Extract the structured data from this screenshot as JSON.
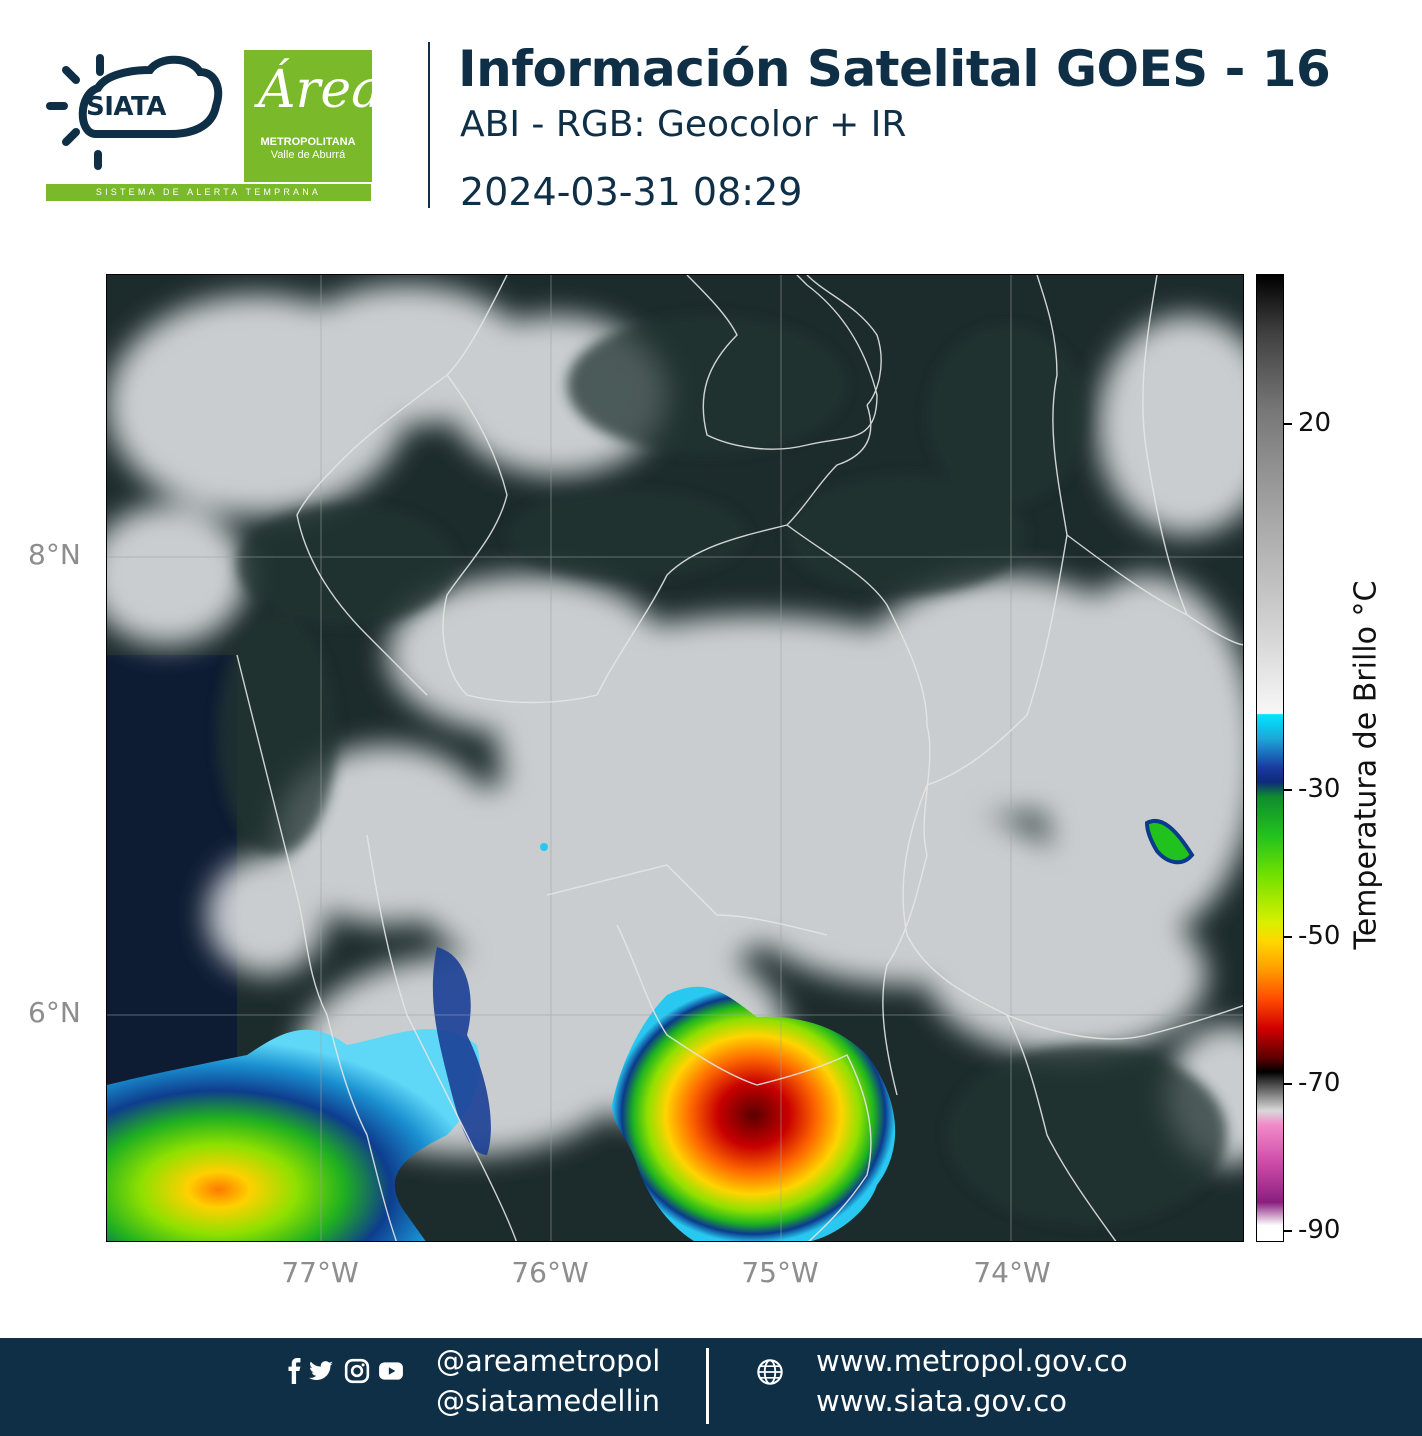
{
  "header": {
    "siata_logo_text": "SIATA",
    "area_logo_script": "Área",
    "area_logo_line1": "METROPOLITANA",
    "area_logo_line2": "Valle de Aburrá",
    "siata_tagline": "SISTEMA DE ALERTA TEMPRANA",
    "title": "Información Satelital GOES - 16",
    "subtitle": "ABI - RGB: Geocolor + IR",
    "timestamp": "2024-03-31 08:29"
  },
  "map": {
    "lat_labels": [
      "8°N",
      "6°N"
    ],
    "lon_labels": [
      "77°W",
      "76°W",
      "75°W",
      "74°W"
    ]
  },
  "colorbar": {
    "title": "Temperatura de Brillo °C",
    "ticks": [
      "20",
      "-30",
      "-50",
      "-70",
      "-90"
    ]
  },
  "footer": {
    "social_icons": [
      "facebook-icon",
      "twitter-icon",
      "instagram-icon",
      "youtube-icon",
      "globe-icon"
    ],
    "handle_1": "@areametropol",
    "handle_2": "@siatamedellin",
    "url_1": "www.metropol.gov.co",
    "url_2": "www.siata.gov.co"
  }
}
